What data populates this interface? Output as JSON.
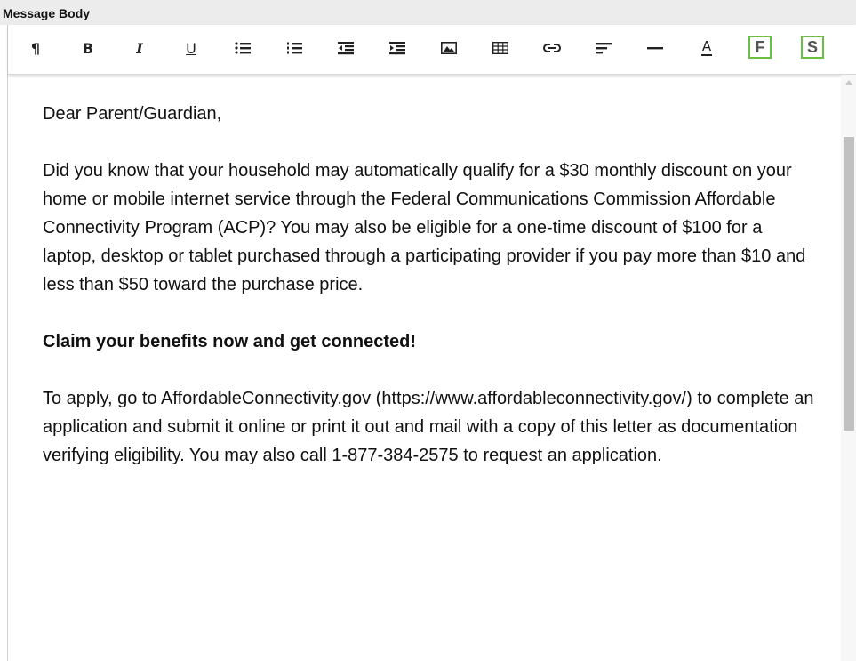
{
  "section": {
    "title": "Message Body"
  },
  "toolbar": {
    "paragraph": "¶",
    "bold": "B",
    "italic": "I",
    "underline": "U",
    "font_color": "A",
    "f_badge": "F",
    "s_badge": "S",
    "badge_color": "#6abf40"
  },
  "document": {
    "greeting": "Dear Parent/Guardian,",
    "para1": "Did you know that your household may automatically qualify for a $30 monthly discount on your home or mobile internet service through the Federal Communications Commission Affordable Connectivity Program (ACP)? You may also be eligible for a one-time discount of $100 for a laptop, desktop or tablet purchased through a participating provider if you pay more than $10 and less than $50 toward the purchase price.",
    "heading": "Claim your benefits now and get connected!",
    "para2": "To apply, go to AffordableConnectivity.gov (https://www.affordableconnectivity.gov/) to complete an application and submit it online or print it out and mail with a copy of this letter as documentation verifying eligibility. You may also call 1-877-384-2575 to request an application."
  }
}
